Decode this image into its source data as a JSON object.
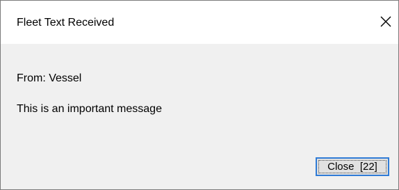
{
  "window": {
    "title": "Fleet Text Received",
    "close_icon": "close-icon"
  },
  "message": {
    "from": "From: Vessel",
    "body": "This is an important message"
  },
  "buttons": {
    "close_label": "Close  [22]"
  },
  "colors": {
    "dialog_background": "#f0f0f0",
    "title_background": "#ffffff",
    "button_focus_border": "#2f7bd6",
    "button_face": "#e1e1e1"
  }
}
